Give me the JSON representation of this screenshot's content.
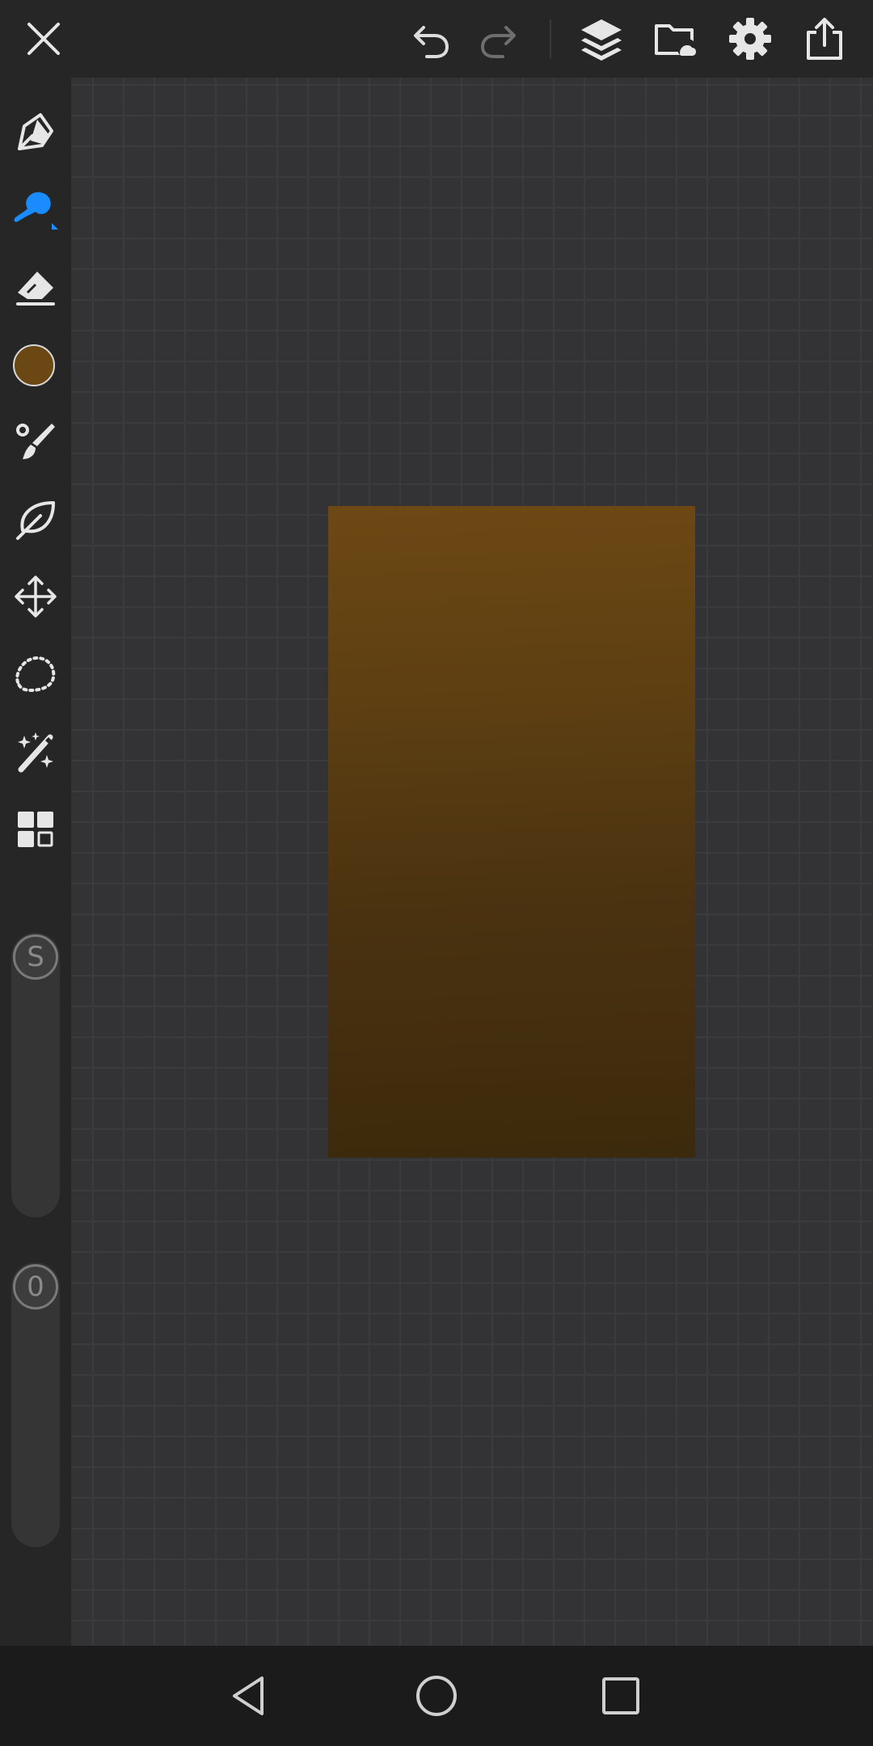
{
  "app": {
    "accent_color": "#1a8cff",
    "icon_color": "#e6e6e6"
  },
  "toolbar": {
    "left": [
      "close-icon"
    ],
    "right": [
      "undo-icon",
      "redo-icon",
      "layers-icon",
      "gallery-icon",
      "settings-icon",
      "share-icon"
    ]
  },
  "sidebar": {
    "tools": [
      "pen-icon",
      "smudge-brush-icon",
      "eraser-icon",
      "color-swatch",
      "paint-brush-icon",
      "leaf-brush-icon",
      "move-icon",
      "lasso-icon",
      "magic-wand-icon",
      "grid-icon"
    ],
    "active_tool": "smudge-brush-icon",
    "current_color": "#6b4714",
    "size_slider": {
      "label": "S"
    },
    "opacity_slider": {
      "label": "0"
    }
  },
  "canvas": {
    "background_color": "#333335",
    "artwork_colors": [
      "#6d4814",
      "#3c2a0c"
    ]
  },
  "navbar": [
    "back-icon",
    "home-icon",
    "recents-icon"
  ]
}
